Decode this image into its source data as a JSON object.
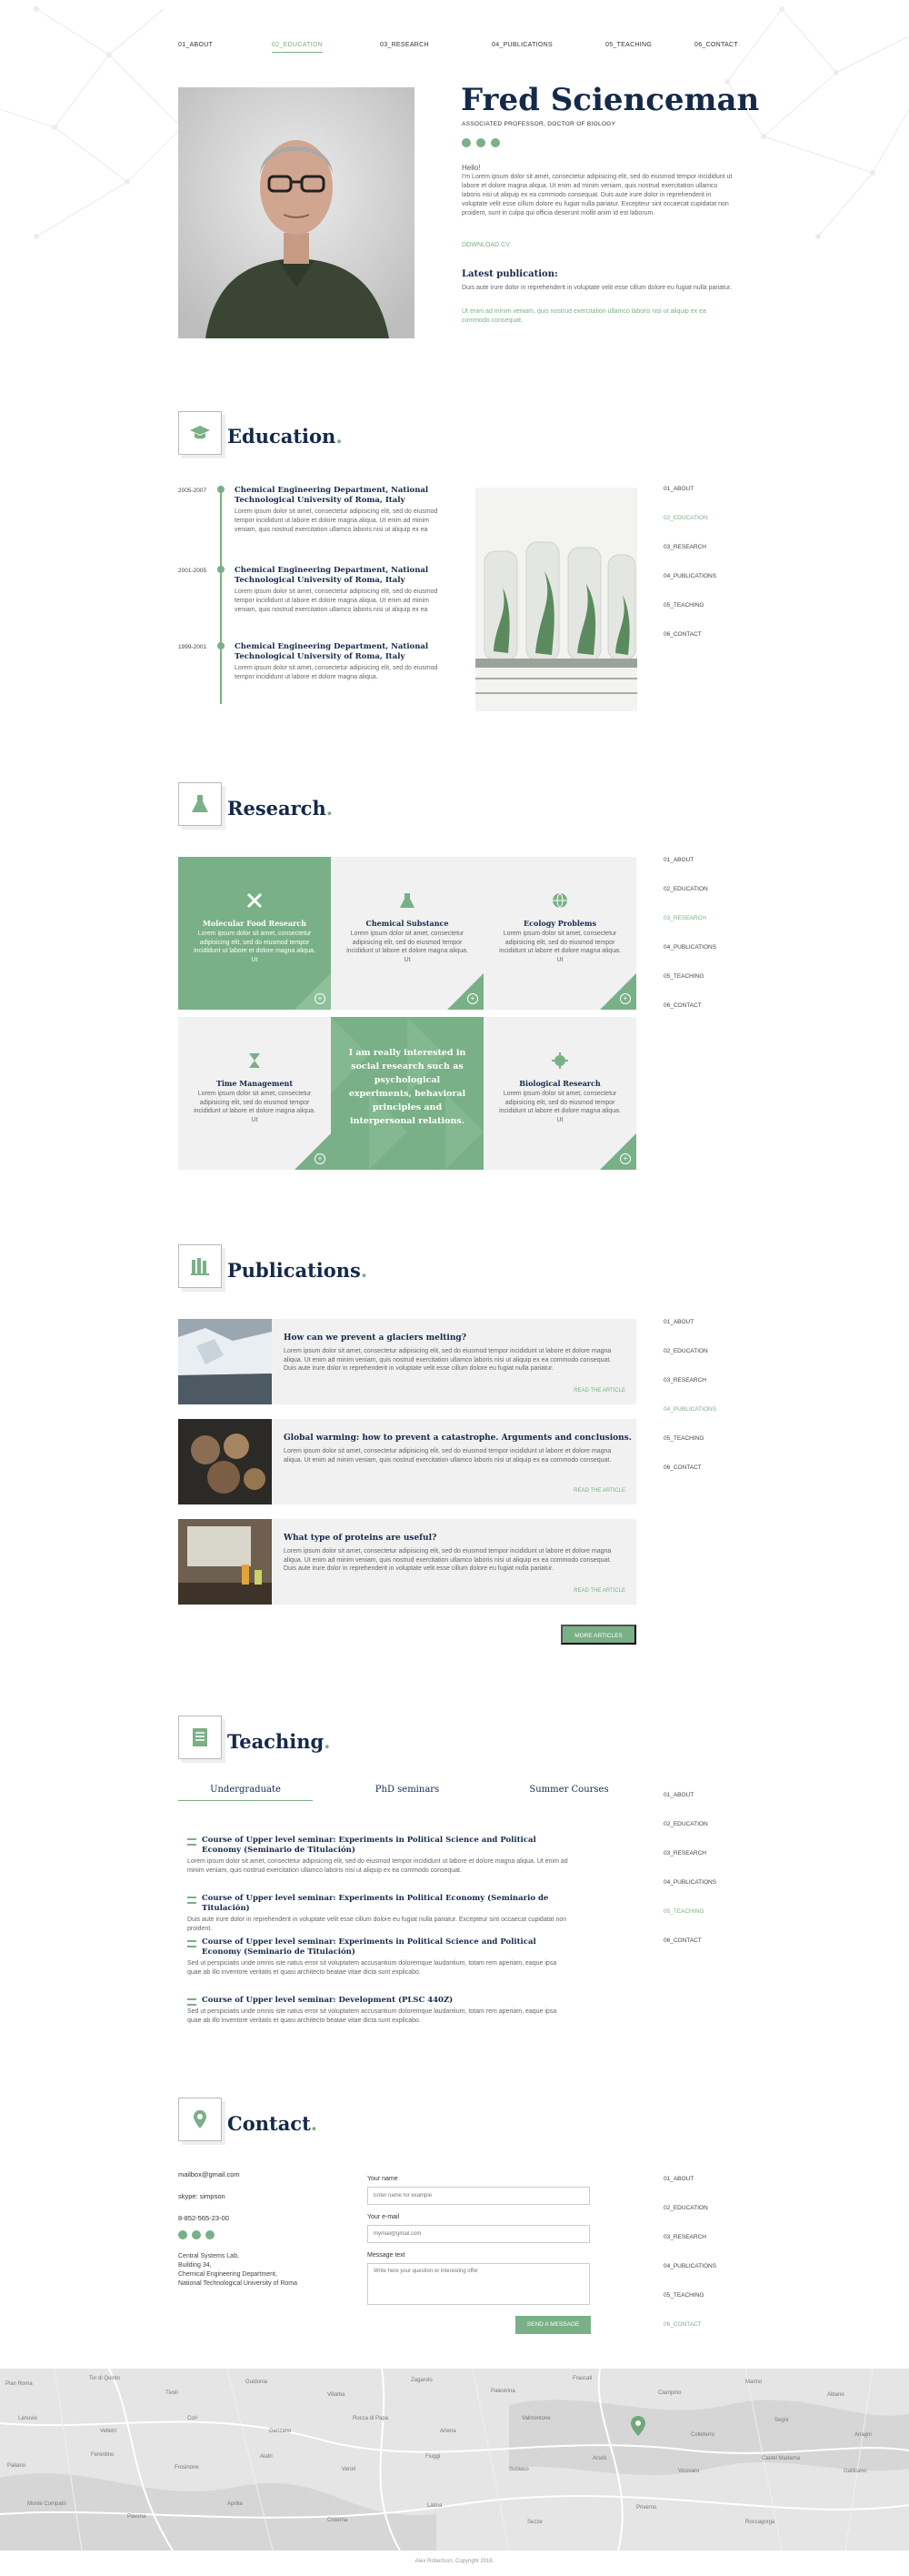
{
  "nav": {
    "items": [
      "01_ABOUT",
      "02_EDUCATION",
      "03_RESEARCH",
      "04_PUBLICATIONS",
      "05_TEACHING",
      "06_CONTACT"
    ],
    "active": "02_EDUCATION"
  },
  "hero": {
    "name": "Fred Scienceman",
    "role": "ASSOCIATED PROFESSOR, DOCTOR OF BIOLOGY",
    "hello": "Hello!",
    "bio": "I'm Lorem ipsum dolor sit amet, consectetur adipisicing elit, sed do eiusmod tempor incididunt ut labore et dolore magna aliqua. Ut enim ad minim veniam, quis nostrud exercitation ullamco laboris nisi ut aliquip ex ea commodo consequat. Duis aute irure dolor in reprehenderit in voluptate velit esse cillum dolore eu fugiat nulla pariatur. Excepteur sint occaecat cupidatat non proident, sunt in culpa qui officia deserunt mollit anim id est laborum.",
    "download": "DOWNLOAD CV",
    "latest_title": "Latest publication:",
    "latest_text": "Duis aute irure dolor in reprehenderit in voluptate velit esse cillum dolore eu fugiat nulla pariatur.",
    "latest_link": "Ut enim ad minim veniam, quis nostrud exercitation ullamco laboris nisi ut aliquip ex ea commodo consequat."
  },
  "education": {
    "title": "Education",
    "items": [
      {
        "date": "2005-2007",
        "title": "Chemical Engineering Department, National Technological University of Roma, Italy",
        "text": "Lorem ipsum dolor sit amet, consectetur adipisicing elit, sed do eiusmod tempor incididunt ut labore et dolore magna aliqua. Ut enim ad minim veniam, quis nostrud exercitation ullamco laboris nisi ut aliquip ex ea"
      },
      {
        "date": "2001-2005",
        "title": "Chemical Engineering Department, National Technological University of Roma, Italy",
        "text": "Lorem ipsum dolor sit amet, consectetur adipisicing elit, sed do eiusmod tempor incididunt ut labore et dolore magna aliqua. Ut enim ad minim veniam, quis nostrud exercitation ullamco laboris nisi ut aliquip ex ea"
      },
      {
        "date": "1999-2001",
        "title": "Chemical Engineering Department, National Technological University of Roma, Italy",
        "text": "Lorem ipsum dolor sit amet, consectetur adipisicing elit, sed do eiusmod tempor incididunt ut labore et dolore magna aliqua."
      }
    ]
  },
  "research": {
    "title": "Research",
    "tiles": [
      {
        "title": "Molecular Food Research",
        "text": "Lorem ipsum dolor sit amet, consectetur adipisicing elit, sed do eiusmod tempor incididunt ut labore et dolore magna aliqua. Ut"
      },
      {
        "title": "Chemical Substance",
        "text": "Lorem ipsum dolor sit amet, consectetur adipisicing elit, sed do eiusmod tempor incididunt ut labore et dolore magna aliqua. Ut"
      },
      {
        "title": "Ecology Problems",
        "text": "Lorem ipsum dolor sit amet, consectetur adipisicing elit, sed do eiusmod tempor incididunt ut labore et dolore magna aliqua. Ut"
      },
      {
        "title": "Time Management",
        "text": "Lorem ipsum dolor sit amet, consectetur adipisicing elit, sed do eiusmod tempor incididunt ut labore et dolore magna aliqua. Ut"
      },
      {
        "title": "Biological Research",
        "text": "Lorem ipsum dolor sit amet, consectetur adipisicing elit, sed do eiusmod tempor incididunt ut labore et dolore magna aliqua. Ut"
      }
    ],
    "feature": "I am really interested in social research such as psychological experiments, behavioral principles and interpersonal relations."
  },
  "publications": {
    "title": "Publications",
    "items": [
      {
        "title": "How can we prevent a glaciers melting?",
        "text": "Lorem ipsum dolor sit amet, consectetur adipisicing elit, sed do eiusmod tempor incididunt ut labore et dolore magna aliqua. Ut enim ad minim veniam, quis nostrud exercitation ullamco laboris nisi ut aliquip ex ea commodo consequat. Duis aute irure dolor in reprehenderit in voluptate velit esse cillum dolore eu fugiat nulla pariatur.",
        "link": "READ THE ARTICLE"
      },
      {
        "title": "Global warming: how to prevent a catastrophe. Arguments and conclusions.",
        "text": "Lorem ipsum dolor sit amet, consectetur adipisicing elit, sed do eiusmod tempor incididunt ut labore et dolore magna aliqua. Ut enim ad minim veniam, quis nostrud exercitation ullamco laboris nisi ut aliquip ex ea commodo consequat.",
        "link": "READ THE ARTICLE"
      },
      {
        "title": "What type of proteins are useful?",
        "text": "Lorem ipsum dolor sit amet, consectetur adipisicing elit, sed do eiusmod tempor incididunt ut labore et dolore magna aliqua. Ut enim ad minim veniam, quis nostrud exercitation ullamco laboris nisi ut aliquip ex ea commodo consequat. Duis aute irure dolor in reprehenderit in voluptate velit esse cillum dolore eu fugiat nulla pariatur.",
        "link": "READ THE ARTICLE"
      }
    ],
    "more": "MORE ARTICLES"
  },
  "teaching": {
    "title": "Teaching",
    "tabs": [
      "Undergraduate",
      "PhD seminars",
      "Summer Courses"
    ],
    "courses": [
      {
        "title": "Course of Upper level seminar: Experiments in Political Science and Political Economy (Seminario de Titulación)",
        "text": "Lorem ipsum dolor sit amet, consectetur adipisicing elit, sed do eiusmod tempor incididunt ut labore et dolore magna aliqua. Ut enim ad minim veniam, quis nostrud exercitation ullamco laboris nisi ut aliquip ex ea commodo consequat."
      },
      {
        "title": "Course of Upper level seminar: Experiments in Political Economy (Seminario de Titulación)",
        "text": "Duis aute irure dolor in reprehenderit in voluptate velit esse cillum dolore eu fugiat nulla pariatur. Excepteur sint occaecat cupidatat non proident."
      },
      {
        "title": "Course of Upper level seminar: Experiments in Political Science and Political Economy (Seminario de Titulación)",
        "text": "Sed ut perspiciatis unde omnis iste natus error sit voluptatem accusantium doloremque laudantium, totam rem aperiam, eaque ipsa quae ab illo inventore veritatis et quasi architecto beatae vitae dicta sunt explicabo."
      },
      {
        "title": "Course of Upper level seminar: Development (PLSC 440Z)",
        "text": "Sed ut perspiciatis unde omnis iste natus error sit voluptatem accusantium doloremque laudantium, totam rem aperiam, eaque ipsa quae ab illo inventore veritatis et quasi architecto beatae vitae dicta sunt explicabo."
      }
    ]
  },
  "contact": {
    "title": "Contact",
    "email": "mailbox@gmail.com",
    "skype": "skype: simpson",
    "phone": "8-852-565-23-00",
    "address": [
      "Central Systems Lab,",
      "Building 34,",
      "Chemical Engineering Department,",
      "National Technological University of Roma"
    ],
    "form": {
      "name_label": "Your name",
      "name_placeholder": "Enter name for example",
      "email_label": "Your e-mail",
      "email_placeholder": "mymail@gmail.com",
      "message_label": "Message text",
      "message_placeholder": "Write here your question or interesting offer",
      "send": "SEND A MESSAGE"
    }
  },
  "map": {
    "labels": [
      "Pian Roma",
      "Tor di Quinto",
      "Tivoli",
      "Guidonia",
      "Villalba",
      "Zagarolo",
      "Palestrina",
      "Frascati",
      "Ciampino",
      "Marino",
      "Albano",
      "Lanuvio",
      "Velletri",
      "Cori",
      "Genzano",
      "Rocca di Papa",
      "Artena",
      "Valmontone",
      "Colleferro",
      "Segni",
      "Anagni",
      "Paliano",
      "Ferentino",
      "Frosinone",
      "Alatri",
      "Veroli",
      "Fiuggi",
      "Subiaco",
      "Arsoli",
      "Vicovaro",
      "Castel Madama",
      "Gallicano",
      "Monte Compatri",
      "Pavona",
      "Aprilia",
      "Cisterna",
      "Latina",
      "Sezze",
      "Priverno",
      "Roccagorga"
    ]
  },
  "copyright": "Alex Robertson. Copyright 2016.",
  "colors": {
    "accent": "#7ab087",
    "navy": "#15294a"
  }
}
